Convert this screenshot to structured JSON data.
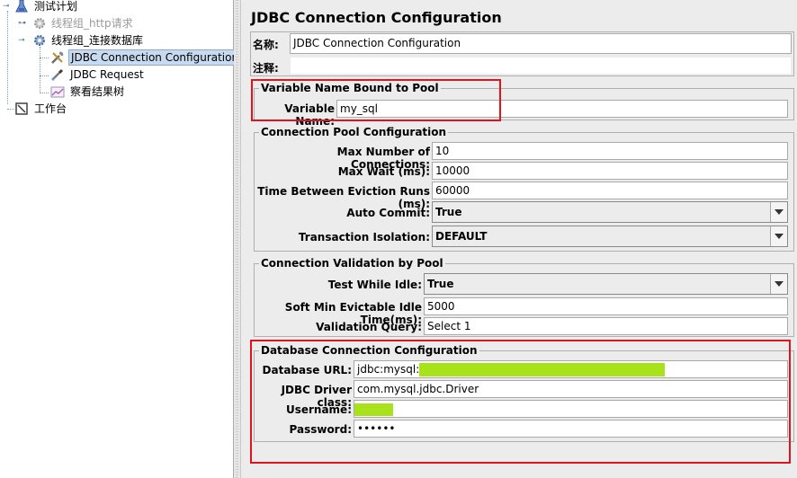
{
  "tree": {
    "items": [
      {
        "label": "测试计划",
        "icon": "flask-icon"
      },
      {
        "label": "线程组_http请求",
        "icon": "gear-icon"
      },
      {
        "label": "线程组_连接数据库",
        "icon": "gear-icon"
      },
      {
        "label": "JDBC Connection Configuration",
        "icon": "wrench-icon"
      },
      {
        "label": "JDBC Request",
        "icon": "pipette-icon"
      },
      {
        "label": "察看结果树",
        "icon": "chart-icon"
      },
      {
        "label": "工作台",
        "icon": "workbench-icon"
      }
    ]
  },
  "panel": {
    "title": "JDBC Connection Configuration",
    "name_label": "名称:",
    "name_value": "JDBC Connection Configuration",
    "comment_label": "注释:",
    "comment_value": ""
  },
  "variable_group": {
    "title": "Variable Name Bound to Pool",
    "label": "Variable Name:",
    "value": "my_sql"
  },
  "pool_group": {
    "title": "Connection Pool Configuration",
    "rows": [
      {
        "label": "Max Number of Connections:",
        "value": "10"
      },
      {
        "label": "Max Wait (ms):",
        "value": "10000"
      },
      {
        "label": "Time Between Eviction Runs (ms):",
        "value": "60000"
      },
      {
        "label": "Auto Commit:",
        "value": "True"
      },
      {
        "label": "Transaction Isolation:",
        "value": "DEFAULT"
      }
    ]
  },
  "validation_group": {
    "title": "Connection Validation by Pool",
    "rows": [
      {
        "label": "Test While Idle:",
        "value": "True"
      },
      {
        "label": "Soft Min Evictable Idle Time(ms):",
        "value": "5000"
      },
      {
        "label": "Validation Query:",
        "value": "Select 1"
      }
    ]
  },
  "db_group": {
    "title": "Database Connection Configuration",
    "rows": [
      {
        "label": "Database URL:",
        "value": "jdbc:mysql://"
      },
      {
        "label": "JDBC Driver class:",
        "value": "com.mysql.jdbc.Driver"
      },
      {
        "label": "Username:",
        "value": ""
      },
      {
        "label": "Password:",
        "value": "••••••"
      }
    ]
  },
  "colors": {
    "highlight_border": "#e0141e",
    "redaction": "#a8e21a",
    "selection": "#c8daf0"
  }
}
